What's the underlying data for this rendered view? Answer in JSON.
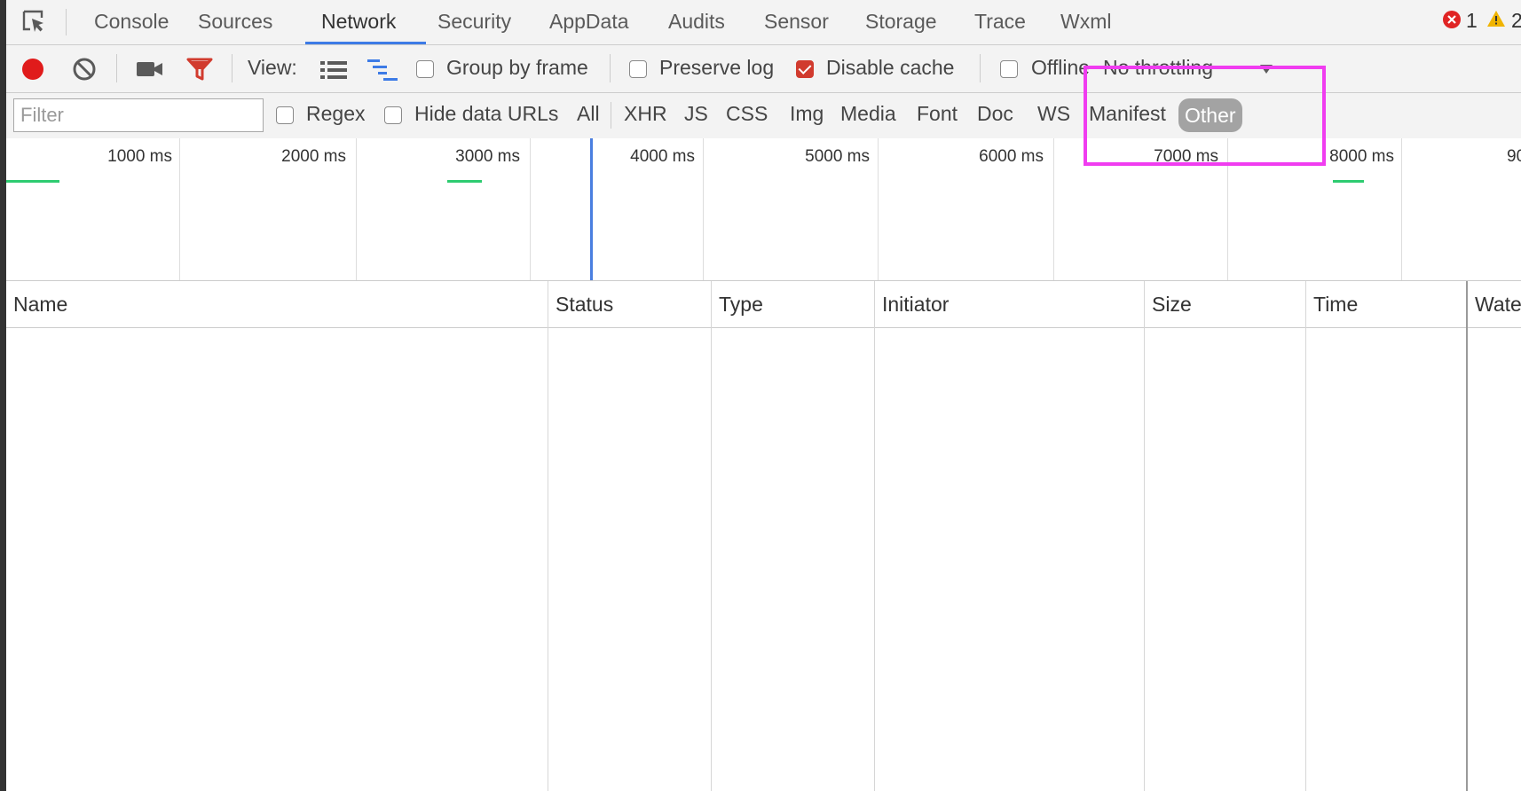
{
  "tabs": {
    "items": [
      {
        "label": "Console"
      },
      {
        "label": "Sources"
      },
      {
        "label": "Network",
        "active": true
      },
      {
        "label": "Security"
      },
      {
        "label": "AppData"
      },
      {
        "label": "Audits"
      },
      {
        "label": "Sensor"
      },
      {
        "label": "Storage"
      },
      {
        "label": "Trace"
      },
      {
        "label": "Wxml"
      }
    ],
    "error_count": "1",
    "warning_count": "2"
  },
  "toolbar": {
    "view_label": "View:",
    "group_by_frame": {
      "label": "Group by frame",
      "checked": false
    },
    "preserve_log": {
      "label": "Preserve log",
      "checked": false
    },
    "disable_cache": {
      "label": "Disable cache",
      "checked": true
    },
    "offline": {
      "label": "Offline",
      "checked": false
    },
    "throttling": "No throttling"
  },
  "filterbar": {
    "placeholder": "Filter",
    "regex": {
      "label": "Regex",
      "checked": false
    },
    "hide_data_urls": {
      "label": "Hide data URLs",
      "checked": false
    },
    "types": [
      "All",
      "XHR",
      "JS",
      "CSS",
      "Img",
      "Media",
      "Font",
      "Doc",
      "WS",
      "Manifest",
      "Other"
    ],
    "selected_type": "Other"
  },
  "timeline": {
    "ticks": [
      "1000 ms",
      "2000 ms",
      "3000 ms",
      "4000 ms",
      "5000 ms",
      "6000 ms",
      "7000 ms",
      "8000 ms",
      "90"
    ]
  },
  "table": {
    "columns": [
      "Name",
      "Status",
      "Type",
      "Initiator",
      "Size",
      "Time",
      "Wate"
    ]
  },
  "colors": {
    "accent": "#3d7be6",
    "record": "#e01b1b",
    "filter_active": "#d13b2e",
    "highlight": "#f03cf0",
    "timeline_bar": "#2ecc71"
  }
}
